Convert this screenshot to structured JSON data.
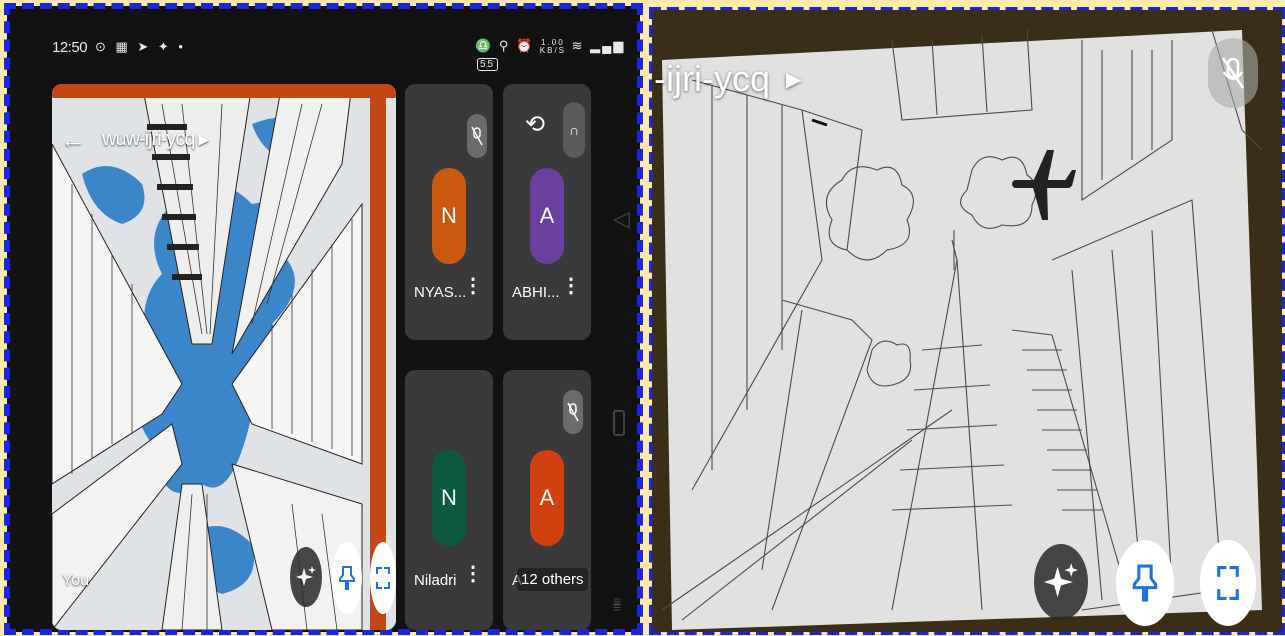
{
  "left": {
    "status": {
      "time": "12:50",
      "speed_value": "1.00",
      "speed_unit": "KB/S",
      "battery": "55"
    },
    "meeting_code": "wuw-ijri-ycq",
    "self_label": "You",
    "participants": [
      {
        "initial": "N",
        "name": "NYAS...",
        "color": "#c9590f"
      },
      {
        "initial": "A",
        "name": "ABHI...",
        "color": "#6a3fa0"
      },
      {
        "initial": "N",
        "name": "Niladri",
        "color": "#0d5a3f"
      },
      {
        "initial": "A",
        "name": "A",
        "color": "#d0410f"
      }
    ],
    "others_label": "12 others"
  },
  "right": {
    "meeting_code_partial": "-ijri-ycq"
  },
  "colors": {
    "frame_blue": "#1a25e0",
    "frame_yellow": "#fde9a8",
    "accent_blue": "#1a73e8"
  },
  "icons": {
    "back": "arrow-left",
    "effects": "sparkle",
    "pin": "pin",
    "fullscreen": "corners",
    "switch_camera": "rotate-camera",
    "audio": "headphones",
    "mic_off": "mic-slash",
    "more": "vertical-dots"
  }
}
